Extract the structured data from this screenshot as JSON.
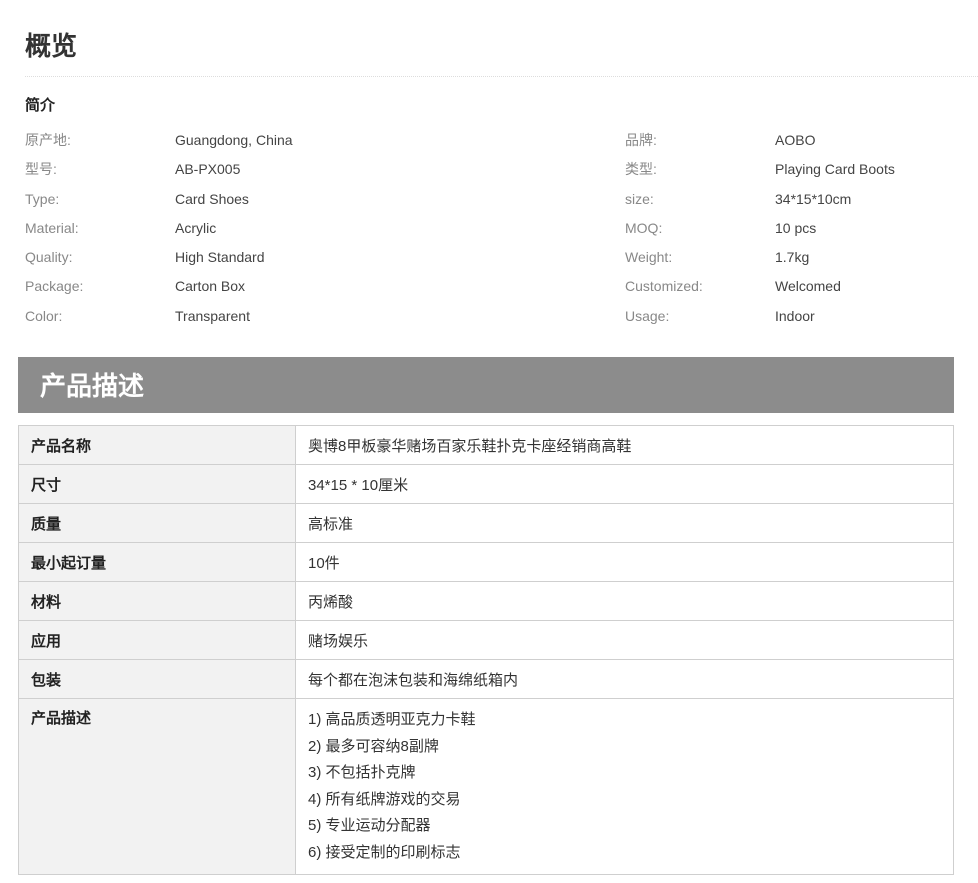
{
  "overview": {
    "title": "概览",
    "intro_title": "简介"
  },
  "specs": [
    {
      "label": "原产地:",
      "value": "Guangdong, China",
      "label2": "品牌:",
      "value2": "AOBO"
    },
    {
      "label": "型号:",
      "value": "AB-PX005",
      "label2": "类型:",
      "value2": "Playing Card Boots"
    },
    {
      "label": "Type:",
      "value": "Card Shoes",
      "label2": "size:",
      "value2": "34*15*10cm"
    },
    {
      "label": "Material:",
      "value": "Acrylic",
      "label2": "MOQ:",
      "value2": "10 pcs"
    },
    {
      "label": "Quality:",
      "value": "High Standard",
      "label2": "Weight:",
      "value2": "1.7kg"
    },
    {
      "label": "Package:",
      "value": "Carton Box",
      "label2": "Customized:",
      "value2": "Welcomed"
    },
    {
      "label": "Color:",
      "value": "Transparent",
      "label2": "Usage:",
      "value2": "Indoor"
    }
  ],
  "description": {
    "header": "产品描述",
    "rows": [
      {
        "key": "产品名称",
        "value": "奥博8甲板豪华赌场百家乐鞋扑克卡座经销商高鞋"
      },
      {
        "key": "尺寸",
        "value": "34*15 * 10厘米"
      },
      {
        "key": "质量",
        "value": "高标准"
      },
      {
        "key": "最小起订量",
        "value": "10件"
      },
      {
        "key": "材料",
        "value": "丙烯酸"
      },
      {
        "key": "应用",
        "value": "赌场娱乐"
      },
      {
        "key": "包装",
        "value": "每个都在泡沫包装和海绵纸箱内"
      }
    ],
    "features_key": "产品描述",
    "features": [
      "1) 高品质透明亚克力卡鞋",
      "2) 最多可容纳8副牌",
      "3) 不包括扑克牌",
      "4) 所有纸牌游戏的交易",
      "5) 专业运动分配器",
      "6) 接受定制的印刷标志"
    ]
  }
}
